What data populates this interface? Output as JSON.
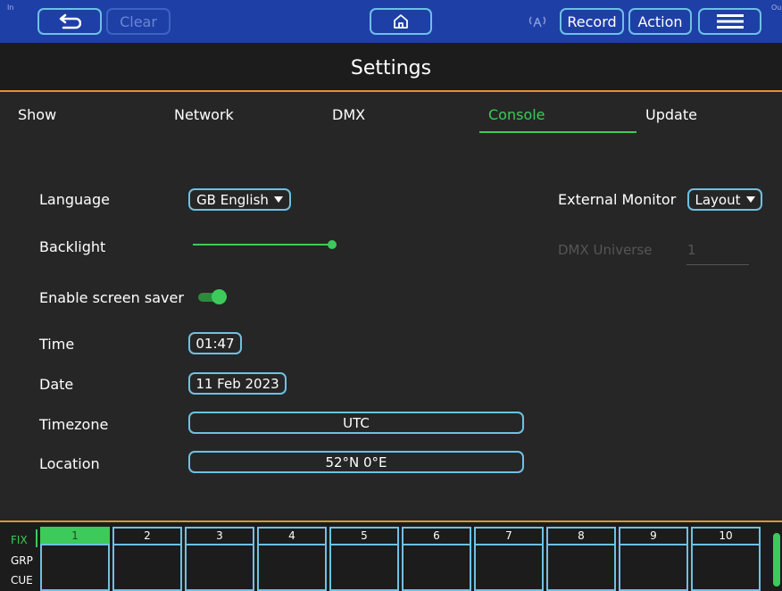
{
  "topbar": {
    "in_label": "In",
    "out_label": "Ou",
    "clear_label": "Clear",
    "record_label": "Record",
    "action_label": "Action"
  },
  "page": {
    "title": "Settings"
  },
  "tabs": [
    {
      "label": "Show",
      "active": false
    },
    {
      "label": "Network",
      "active": false
    },
    {
      "label": "DMX",
      "active": false
    },
    {
      "label": "Console",
      "active": true
    },
    {
      "label": "Update",
      "active": false
    }
  ],
  "settings": {
    "language_label": "Language",
    "language_value": "GB English",
    "backlight_label": "Backlight",
    "backlight_level": 1.0,
    "screensaver_label": "Enable screen saver",
    "screensaver_on": true,
    "time_label": "Time",
    "time_value": "01:47",
    "date_label": "Date",
    "date_value": "11 Feb 2023",
    "timezone_label": "Timezone",
    "timezone_value": "UTC",
    "location_label": "Location",
    "location_value": "52°N 0°E",
    "external_monitor_label": "External Monitor",
    "external_monitor_value": "Layout",
    "dmx_universe_label": "DMX Universe",
    "dmx_universe_value": "1"
  },
  "bottom": {
    "modes": [
      "FIX",
      "GRP",
      "CUE"
    ],
    "active_mode": "FIX",
    "slots": [
      "1",
      "2",
      "3",
      "4",
      "5",
      "6",
      "7",
      "8",
      "9",
      "10"
    ],
    "active_slot": "1"
  },
  "colors": {
    "accent_green": "#3ccb5a",
    "topbar_blue": "#1e3fa6",
    "outline_cyan": "#6ec1e4",
    "separator_orange": "#e0952a"
  }
}
